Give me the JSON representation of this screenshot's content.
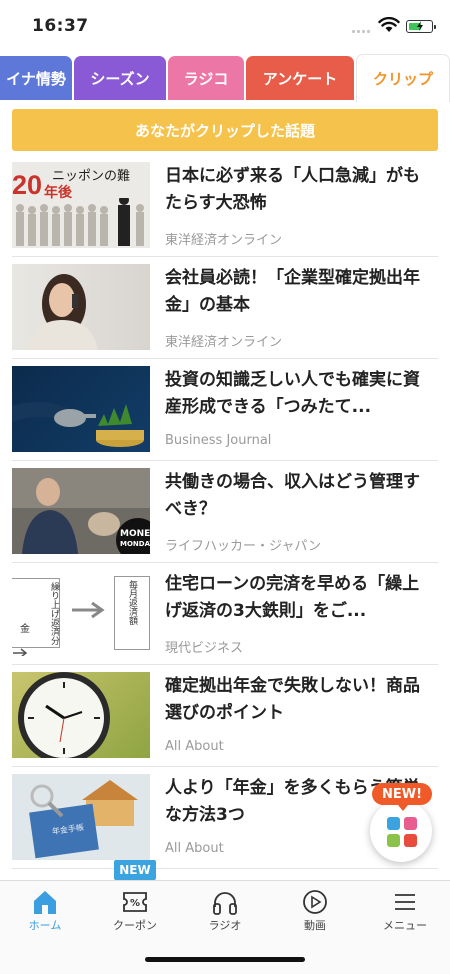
{
  "status_bar": {
    "time": "16:37"
  },
  "tabs": [
    {
      "label": "イナ情勢",
      "color": "#5d78d8"
    },
    {
      "label": "シーズン",
      "color": "#8a5ad6"
    },
    {
      "label": "ラジコ",
      "color": "#ec77a7"
    },
    {
      "label": "アンケート",
      "color": "#e85d4a"
    },
    {
      "label": "クリップ",
      "color": "#f0952b",
      "active": true
    }
  ],
  "banner": {
    "label": "あなたがクリップした話題",
    "color": "#f5c24b"
  },
  "articles": [
    {
      "title": "日本に必ず来る「人口急減」がもたらす大恐怖",
      "source": "東洋経済オンライン",
      "thumb_text_1": "ニッポンの難",
      "thumb_text_2": "20",
      "thumb_text_3": "年後"
    },
    {
      "title": "会社員必読！「企業型確定拠出年金」の基本",
      "source": "東洋経済オンライン"
    },
    {
      "title": "投資の知識乏しい人でも確実に資産形成できる「つみたて...",
      "source": "Business Journal"
    },
    {
      "title": "共働きの場合、収入はどう管理すべき？",
      "source": "ライフハッカー・ジャパン",
      "thumb_text_1": "MONEY",
      "thumb_text_2": "MONDAY"
    },
    {
      "title": "住宅ローンの完済を早める「繰上げ返済の3大鉄則」をご...",
      "source": "現代ビジネス",
      "thumb_text_1": "毎月返済額",
      "thumb_text_2": "繰り上げ返済分",
      "thumb_text_3": "金"
    },
    {
      "title": "確定拠出年金で失敗しない！商品選びのポイント",
      "source": "All About"
    },
    {
      "title": "人より「年金」を多くもらう簡単な方法3つ",
      "source": "All About",
      "thumb_text_1": "年金手帳"
    }
  ],
  "fab": {
    "badge": "NEW!"
  },
  "bottom_nav": {
    "new_badge": "NEW",
    "items": [
      {
        "label": "ホーム",
        "icon": "home-icon",
        "active": true
      },
      {
        "label": "クーポン",
        "icon": "coupon-icon"
      },
      {
        "label": "ラジオ",
        "icon": "headphones-icon"
      },
      {
        "label": "動画",
        "icon": "play-icon"
      },
      {
        "label": "メニュー",
        "icon": "menu-icon"
      }
    ]
  },
  "colors": {
    "accent": "#3a9ee0",
    "banner": "#f5c24b",
    "badge": "#f05a28"
  }
}
